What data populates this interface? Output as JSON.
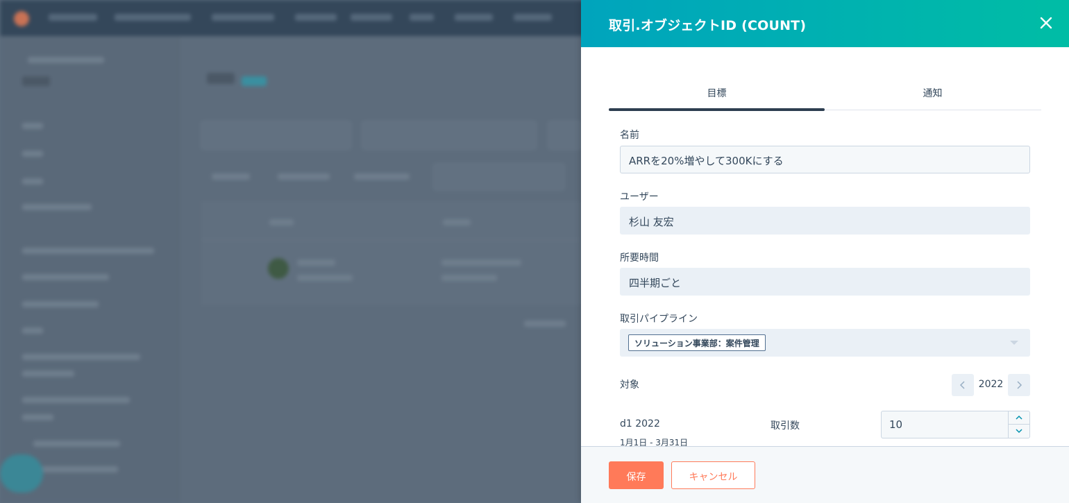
{
  "panel": {
    "title": "取引.オブジェクトID (COUNT)",
    "tabs": [
      {
        "label": "目標"
      },
      {
        "label": "通知"
      }
    ]
  },
  "form": {
    "name_label": "名前",
    "name_value": "ARRを20%増やして300Kにする",
    "user_label": "ユーザー",
    "user_value": "杉山 友宏",
    "duration_label": "所要時間",
    "duration_value": "四半期ごと",
    "pipeline_label": "取引パイプライン",
    "pipeline_value": "ソリューション事業部：案件管理",
    "target_label": "対象",
    "year": "2022",
    "period_name": "d1  2022",
    "period_range": "1月1日 - 3月31日",
    "deals_label": "取引数",
    "deals_value": "10"
  },
  "footer": {
    "save_label": "保存",
    "cancel_label": "キャンセル"
  },
  "colors": {
    "header_start": "#00a4bd",
    "header_end": "#00bda5",
    "primary_button": "#ff7a59",
    "text": "#33475b"
  }
}
